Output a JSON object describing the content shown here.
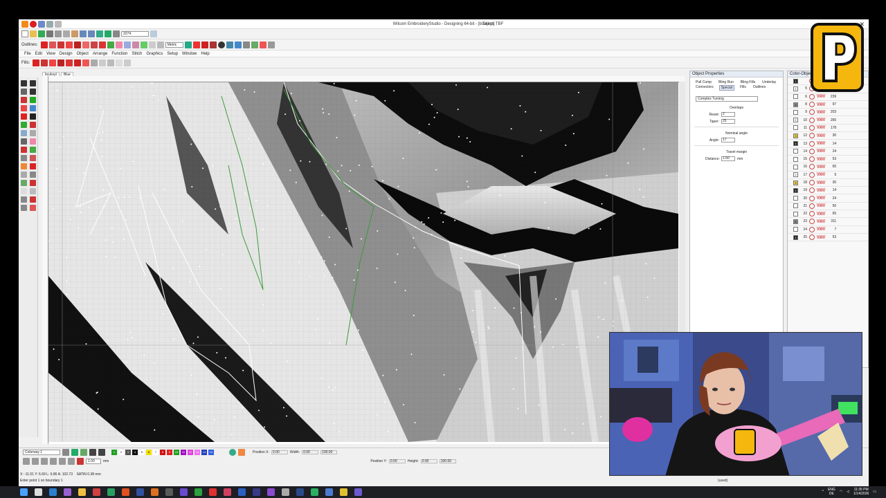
{
  "window": {
    "title": "Wilcom EmbroideryStudio - Designing 64-bit - [bcukxyt]",
    "machine": "Tajima TBF"
  },
  "toolbar": {
    "outlines_label": "Outlines:",
    "fills_label": "Fills:",
    "zoom_value": "2274",
    "units_value": "Metric"
  },
  "menu": [
    "File",
    "Edit",
    "View",
    "Design",
    "Object",
    "Arrange",
    "Function",
    "Stitch",
    "Graphics",
    "Setup",
    "Window",
    "Help"
  ],
  "doc_tabs": [
    "bcukxyt",
    "Blue"
  ],
  "object_properties": {
    "title": "Object Properties",
    "tabs": [
      "Pull Comp",
      "Bling Run",
      "Bling Fills",
      "Underlay",
      "Connectors",
      "Special",
      "Fills",
      "Outlines"
    ],
    "active_tab": "Special",
    "fill_type": "Complex Turning",
    "overlaps_label": "Overlaps",
    "reset_label": "Reset:",
    "reset_value": "2",
    "taper_label": "Taper:",
    "taper_value": "25",
    "nominal_angle_label": "Nominal angle",
    "angle_label": "Angle:",
    "angle_value": "17",
    "travel_margin_label": "Travel margin",
    "distance_label": "Distance:",
    "distance_value": "1.50",
    "distance_unit": "mm"
  },
  "color_object_list": {
    "title": "Color-Object List",
    "rows": [
      {
        "sw": "1",
        "n": "",
        "c": "",
        "color": "#222222"
      },
      {
        "sw": "2",
        "n": "5",
        "c": "883",
        "color": "#ffffff"
      },
      {
        "sw": "",
        "n": "6",
        "c": "239",
        "color": "#ffffff"
      },
      {
        "sw": "3",
        "n": "8",
        "c": "97",
        "color": "#888888"
      },
      {
        "sw": "",
        "n": "9",
        "c": "203",
        "color": "#ffffff"
      },
      {
        "sw": "2",
        "n": "10",
        "c": "265",
        "color": "#ffffff"
      },
      {
        "sw": "",
        "n": "11",
        "c": "178",
        "color": "#ffffff"
      },
      {
        "sw": "3",
        "n": "12",
        "c": "30",
        "color": "#e6c84a"
      },
      {
        "sw": "4",
        "n": "13",
        "c": "14",
        "color": "#222222"
      },
      {
        "sw": "",
        "n": "14",
        "c": "24",
        "color": "#ffffff"
      },
      {
        "sw": "",
        "n": "15",
        "c": "53",
        "color": "#ffffff"
      },
      {
        "sw": "",
        "n": "16",
        "c": "65",
        "color": "#ffffff"
      },
      {
        "sw": "2",
        "n": "17",
        "c": "5",
        "color": "#ffffff"
      },
      {
        "sw": "3",
        "n": "18",
        "c": "30",
        "color": "#e6c84a"
      },
      {
        "sw": "4",
        "n": "19",
        "c": "14",
        "color": "#222222"
      },
      {
        "sw": "",
        "n": "20",
        "c": "24",
        "color": "#ffffff"
      },
      {
        "sw": "",
        "n": "21",
        "c": "50",
        "color": "#ffffff"
      },
      {
        "sw": "",
        "n": "22",
        "c": "65",
        "color": "#ffffff"
      },
      {
        "sw": "5",
        "n": "23",
        "c": "311",
        "color": "#888888"
      },
      {
        "sw": "",
        "n": "24",
        "c": "7",
        "color": "#ffffff"
      },
      {
        "sw": "4",
        "n": "25",
        "c": "53",
        "color": "#222222"
      }
    ]
  },
  "bottom": {
    "colorway": "Colorway 1",
    "zoom_small": "1.00",
    "unit": "mm",
    "pos_x_label": "Position X:",
    "pos_x": "0.00",
    "pos_y_label": "Position Y:",
    "pos_y": "0.00",
    "width_label": "Width:",
    "width": "0.00",
    "height_label": "Height:",
    "height": "0.00",
    "pct1": "100.00",
    "pct2": "100.00",
    "swatches": [
      {
        "n": "1",
        "c": "#20a020"
      },
      {
        "n": "2",
        "c": "#ffffff"
      },
      {
        "n": "3",
        "c": "#555555"
      },
      {
        "n": "4",
        "c": "#111111"
      },
      {
        "n": "5",
        "c": "#ffffff"
      },
      {
        "n": "6",
        "c": "#f0e000"
      },
      {
        "n": "7",
        "c": "#ffffff"
      },
      {
        "n": "8",
        "c": "#d01010"
      },
      {
        "n": "9",
        "c": "#e02020"
      },
      {
        "n": "10",
        "c": "#20a020"
      },
      {
        "n": "11",
        "c": "#a010c0"
      },
      {
        "n": "12",
        "c": "#e040e0"
      },
      {
        "n": "13",
        "c": "#f070f0"
      },
      {
        "n": "14",
        "c": "#2040c0"
      },
      {
        "n": "15",
        "c": "#3060e0"
      }
    ]
  },
  "status": {
    "coords": "X: -11.51 Y: 6.69 L: 6.86 A: 102.73",
    "stitch": "SATIN 0.38 mm",
    "prompt": "Enter point 1 on boundary 1",
    "right": "(used)"
  },
  "taskbar": {
    "lang1": "ENG",
    "lang2": "DE",
    "time": "11:35 PM",
    "date": "1/14/2026"
  },
  "colors": {
    "accent": "#f5b70d",
    "stitch_red": "#cc2222",
    "panel_blue": "#dde8f5"
  }
}
